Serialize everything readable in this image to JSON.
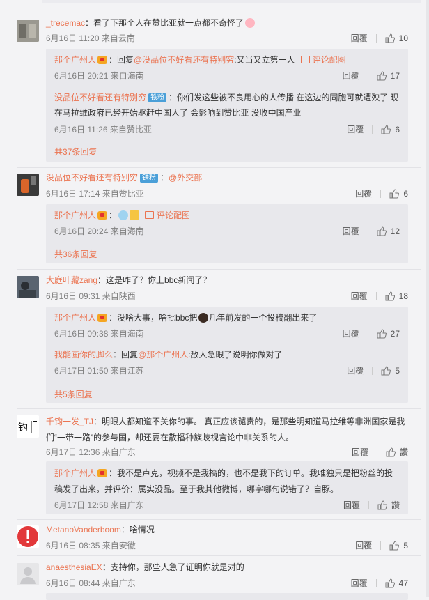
{
  "common": {
    "reply": "回覆",
    "comment_image": "评论配图",
    "iron_fan": "铁粉"
  },
  "comments": [
    {
      "user": "_trecemac",
      "text": "：看了下那个人在赞比亚就一点都不奇怪了",
      "meta": "6月16日 11:20 来自云南",
      "likes": "10",
      "replies": [
        {
          "user": "那个广州人",
          "pre": "：回复",
          "mention": "@没品位不好看还有特别穷",
          "text": ":又当又立第一人",
          "meta": "6月16日 20:21 来自海南",
          "likes": "17"
        },
        {
          "user": "没品位不好看还有特别穷",
          "text": "：你们发这些被不良用心的人传播 在这边的同胞可就遭殃了 现在马拉维政府已经开始驱赶中国人了 会影响到赞比亚 没收中国产业",
          "meta": "6月16日 11:26 来自赞比亚",
          "likes": "6"
        }
      ],
      "more": "共37条回复"
    },
    {
      "user": "没品位不好看还有特别穷",
      "mention": "@外交部",
      "meta": "6月16日 17:14 来自赞比亚",
      "likes": "6",
      "replies": [
        {
          "user": "那个广州人",
          "text": "：",
          "meta": "6月16日 20:24 来自海南",
          "likes": "12"
        }
      ],
      "more": "共36条回复"
    },
    {
      "user": "大庭叶藏zang",
      "text": "：这是咋了？你上bbc新闻了？",
      "meta": "6月16日 09:31 来自陕西",
      "likes": "18",
      "replies": [
        {
          "user": "那个广州人",
          "text": "：没啥大事，啥批bbc把",
          "text2": "几年前发的一个投稿翻出来了",
          "meta": "6月16日 09:38 来自海南",
          "likes": "27"
        },
        {
          "user": "我能画你的脚么",
          "pre": "：回复",
          "mention": "@那个广州人",
          "text": ":敌人急眼了说明你做对了",
          "meta": "6月17日 01:50 来自江苏",
          "likes": "5"
        }
      ],
      "more": "共5条回复"
    },
    {
      "user": "千钧一发_TJ",
      "text": "：明眼人都知道不关你的事。 真正应该谴责的，是那些明知道马拉维等非洲国家是我们“一带一路”的参与国，却还要在散播种族歧视言论中非关系的人。",
      "meta": "6月17日 12:36 来自广东",
      "likes": "讚",
      "replies": [
        {
          "user": "那个广州人",
          "text": "：我不是卢克，视频不是我搞的，也不是我下的订单。我唯独只是把粉丝的投稿发了出来，并评价：属实没品。至于我其他微博，哪字哪句说错了？自豚。",
          "meta": "6月17日 12:58 来自广东",
          "likes": "讚"
        }
      ]
    },
    {
      "user": "MetanoVanderboom",
      "text": "：啥情况",
      "meta": "6月16日 08:35 来自安徽",
      "likes": "5"
    },
    {
      "user": "anaesthesiaEX",
      "text": "：支持你，那些人急了证明你就是对的",
      "meta": "6月16日 08:44 来自广东",
      "likes": "47"
    }
  ]
}
